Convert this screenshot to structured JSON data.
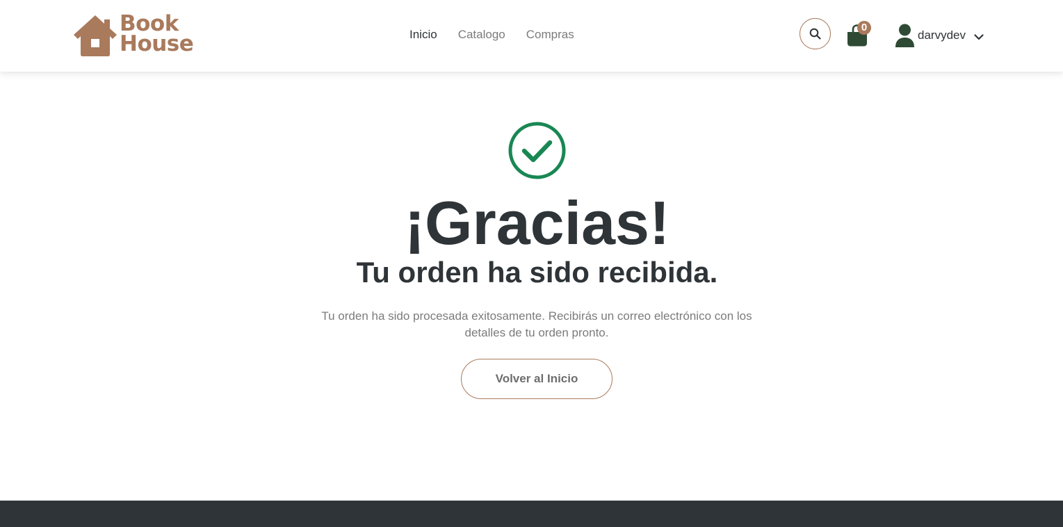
{
  "colors": {
    "brand": "#a97a5c",
    "dark": "#2e3437",
    "cart_green": "#2f4a34",
    "success": "#198754",
    "footer": "#2e3437"
  },
  "header": {
    "logo": {
      "line1": "Book",
      "line2": "House",
      "icon": "house-icon"
    },
    "nav": [
      {
        "label": "Inicio",
        "active": true
      },
      {
        "label": "Catalogo",
        "active": false
      },
      {
        "label": "Compras",
        "active": false
      }
    ],
    "search_icon": "search-icon",
    "cart": {
      "icon": "shopping-bag-icon",
      "count": "0"
    },
    "user": {
      "icon": "user-icon",
      "name": "darvydev",
      "menu_icon": "chevron-down-icon"
    }
  },
  "main": {
    "status_icon": "check-circle-icon",
    "title": "¡Gracias!",
    "subtitle": "Tu orden ha sido recibida.",
    "message": "Tu orden ha sido procesada exitosamente. Recibirás un correo electrónico con los detalles de tu orden pronto.",
    "button_label": "Volver al Inicio"
  }
}
